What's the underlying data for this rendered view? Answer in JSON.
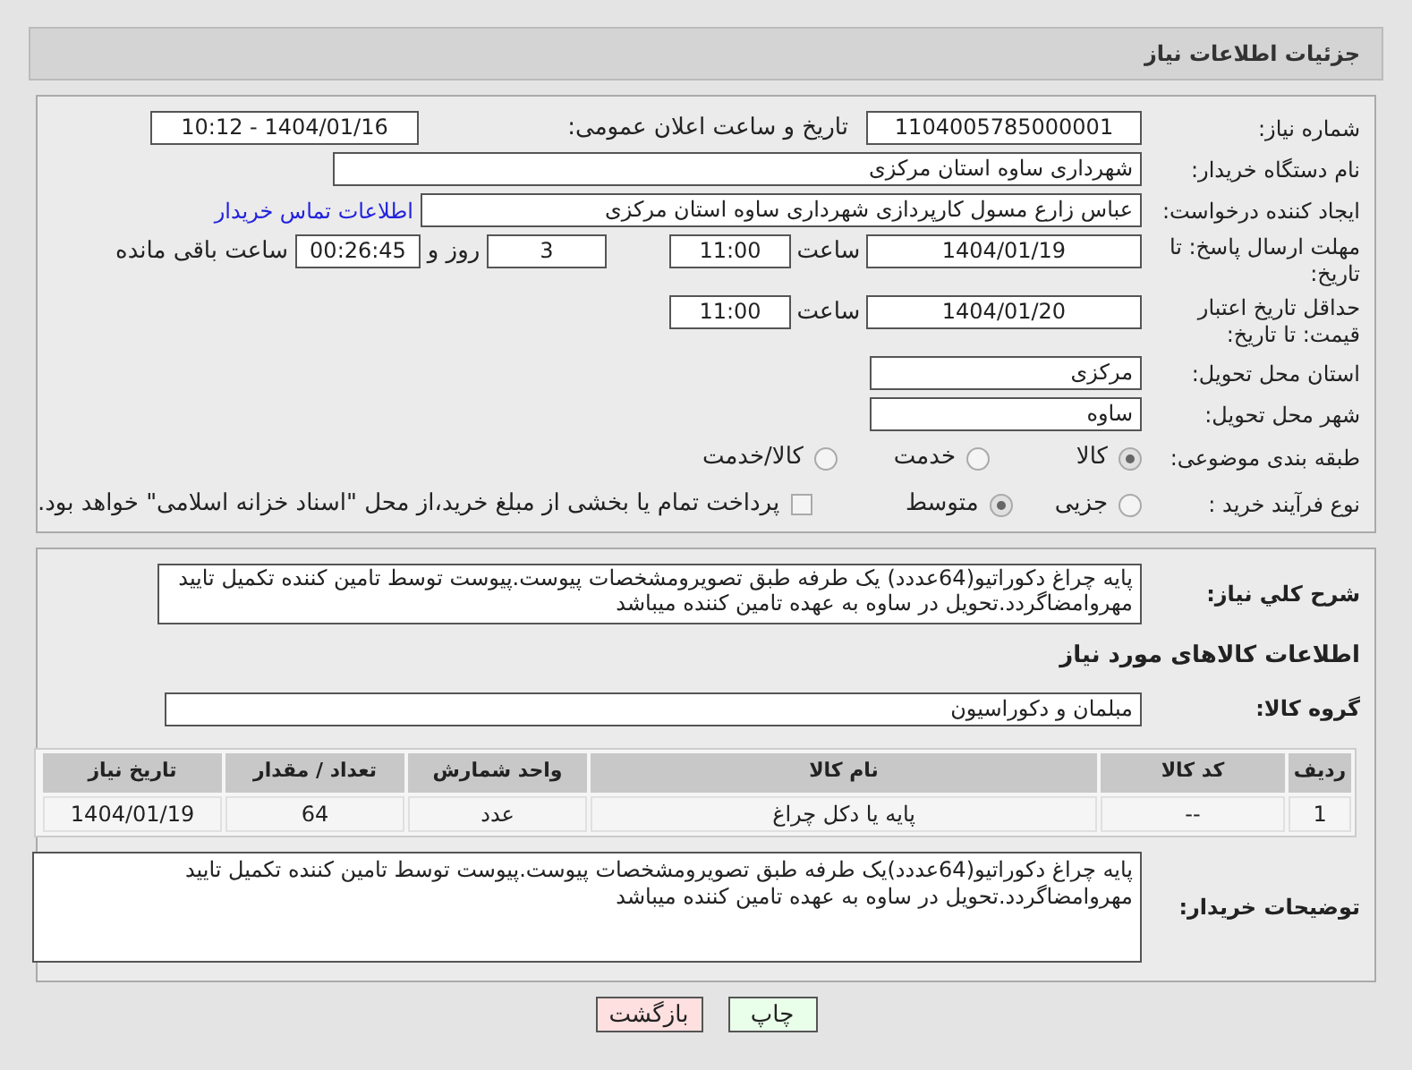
{
  "page_title": "جزئیات اطلاعات نیاز",
  "need_number": {
    "label": "شماره نیاز:",
    "value": "1104005785000001"
  },
  "announce_datetime": {
    "label": "تاریخ و ساعت اعلان عمومی:",
    "value": "1404/01/16 - 10:12"
  },
  "buyer_org": {
    "label": "نام دستگاه خریدار:",
    "value": "شهرداری ساوه استان مرکزی"
  },
  "requester": {
    "label": "ایجاد کننده درخواست:",
    "value": "عباس زارع مسول کارپردازی شهرداری ساوه استان مرکزی",
    "link": "اطلاعات تماس خریدار"
  },
  "response_deadline": {
    "label": "مهلت ارسال پاسخ: تا تاریخ:",
    "date": "1404/01/19",
    "time_label": "ساعت",
    "time": "11:00",
    "days": "3",
    "days_label": "روز و",
    "remaining": "00:26:45",
    "remaining_label": "ساعت باقی مانده"
  },
  "price_validity": {
    "label": "حداقل تاریخ اعتبار قیمت: تا تاریخ:",
    "date": "1404/01/20",
    "time_label": "ساعت",
    "time": "11:00"
  },
  "delivery_province": {
    "label": "استان محل تحویل:",
    "value": "مرکزی"
  },
  "delivery_city": {
    "label": "شهر محل تحویل:",
    "value": "ساوه"
  },
  "subject_category": {
    "label": "طبقه بندی موضوعی:",
    "options": [
      {
        "label": "كالا",
        "selected": true
      },
      {
        "label": "خدمت",
        "selected": false
      },
      {
        "label": "كالا/خدمت",
        "selected": false
      }
    ]
  },
  "purchase_process": {
    "label": "نوع فرآیند خرید :",
    "options": [
      {
        "label": "جزیی",
        "selected": false
      },
      {
        "label": "متوسط",
        "selected": true
      }
    ],
    "payment_option": {
      "label": "پرداخت تمام یا بخشی از مبلغ خرید،از محل \"اسناد خزانه اسلامی\" خواهد بود.",
      "checked": false
    }
  },
  "general_description": {
    "label": "شرح کلي نياز:",
    "value": "پایه چراغ دکوراتیو(64عددد) یک طرفه طبق تصویرومشخصات پیوست.پیوست توسط تامین کننده تکمیل تایید مهروامضاگردد.تحویل در ساوه به عهده تامین کننده میباشد"
  },
  "goods_heading": "اطلاعات کالاهای مورد نیاز",
  "goods_group": {
    "label": "گروه کالا:",
    "value": "مبلمان و دکوراسیون"
  },
  "table": {
    "columns": [
      "ردیف",
      "کد کالا",
      "نام کالا",
      "واحد شمارش",
      "تعداد / مقدار",
      "تاریخ نیاز"
    ],
    "rows": [
      [
        "1",
        "--",
        "پایه یا دکل چراغ",
        "عدد",
        "64",
        "1404/01/19"
      ]
    ]
  },
  "buyer_notes": {
    "label": "توضیحات خریدار:",
    "value": "پایه چراغ دکوراتیو(64عددد)یک طرفه طبق تصویرومشخصات پیوست.پیوست توسط تامین کننده تکمیل تایید مهروامضاگردد.تحویل در ساوه به عهده تامین کننده میباشد"
  },
  "buttons": [
    "چاپ",
    "بازگشت"
  ]
}
